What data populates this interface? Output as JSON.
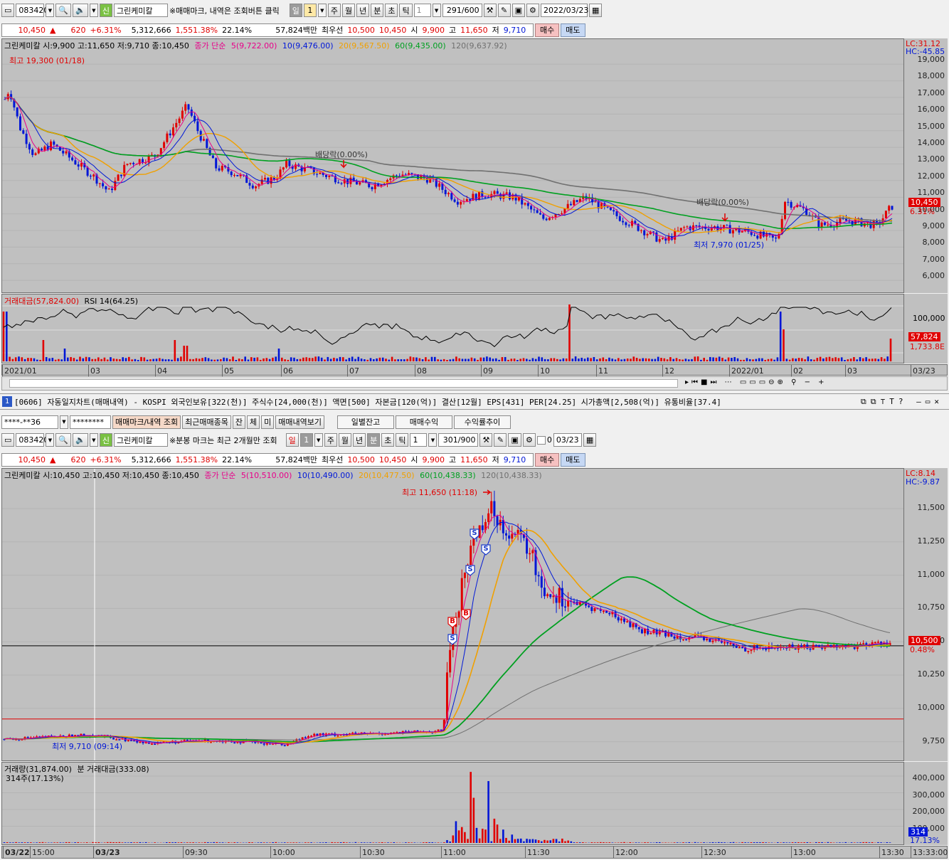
{
  "top_toolbar": {
    "code": "083420",
    "name": "그린케미칼",
    "badge": "신",
    "notice": "※매매마크, 내역은 조회버튼 클릭",
    "periods": [
      "일",
      "1",
      "주",
      "월",
      "년",
      "분",
      "초",
      "틱"
    ],
    "count_value": "1",
    "bars": "291/600",
    "date": "2022/03/23"
  },
  "top_quote": {
    "price": "10,450",
    "arrow": "▲",
    "change": "620",
    "pct": "+6.31%",
    "volume": "5,312,666",
    "vol_pct": "1,551.38%",
    "turnover": "22.14%",
    "amount": "57,824백만",
    "best_label": "최우선",
    "ask": "10,500",
    "bid": "10,450",
    "open_label": "시",
    "open": "9,900",
    "high_label": "고",
    "high": "11,650",
    "low_label": "저",
    "low": "9,710",
    "buy": "매수",
    "sell": "매도"
  },
  "daily_chart": {
    "legend": {
      "name": "그린케미칼 시:9,900 고:11,650 저:9,710 종:10,450",
      "ma_label": "종가 단순",
      "ma5": "5(9,722.00)",
      "ma10": "10(9,476.00)",
      "ma20": "20(9,567.50)",
      "ma60": "60(9,435.00)",
      "ma120": "120(9,637.92)"
    },
    "lc": "LC:31.12",
    "hc": "HC:-45.85",
    "y_ticks": [
      "19,000",
      "18,000",
      "17,000",
      "16,000",
      "15,000",
      "14,000",
      "13,000",
      "12,000",
      "11,000",
      "10,000",
      "9,000",
      "8,000",
      "7,000",
      "6,000"
    ],
    "high_ann": "최고 19,300 (01/18)",
    "low_ann": "최저 7,970 (01/25)",
    "div1": "배당락(0.00%)",
    "div2": "배당락(0.00%)",
    "price_tag": "10,450",
    "pct_tag": "6.31%",
    "colors": {
      "ma5": "#e8008a",
      "ma10": "#0018d8",
      "ma20": "#f0a000",
      "ma60": "#00a020",
      "ma120": "#707070",
      "up": "#e00000",
      "down": "#0016d6"
    }
  },
  "daily_sub": {
    "legend_amount": "거래대금(57,824.00)",
    "legend_rsi": "RSI 14(64.25)",
    "y_tick": "100,000",
    "tag1": "57,824",
    "tag2": "1,733.8E"
  },
  "daily_x": [
    "2021/01",
    "03",
    "04",
    "05",
    "06",
    "07",
    "08",
    "09",
    "10",
    "11",
    "12",
    "2022/01",
    "02",
    "03",
    "03/23"
  ],
  "panel2_title": {
    "num": "1",
    "text": "[0606] 자동일지차트(매매내역) - KOSPI 외국인보유[322(천)] 주식수[24,000(천)] 액면[500] 자본금[120(억)] 결산[12월] EPS[431] PER[24.25] 시가총액[2,508(억)] 유통비율[37.4]"
  },
  "account_bar": {
    "account": "****-**36",
    "password": "********",
    "mark_btn": "매매마크/내역 조회",
    "recent_btn": "최근매매종목",
    "t1": "잔",
    "t2": "체",
    "t3": "미",
    "history_btn": "매매내역보기",
    "btn1": "일별잔고",
    "btn2": "매매수익",
    "btn3": "수익률추이"
  },
  "toolbar2": {
    "code": "083420",
    "name": "그린케미칼",
    "badge": "신",
    "notice": "※분봉 마크는 최근 2개월만 조회",
    "periods": [
      "일",
      "1",
      "주",
      "월",
      "년",
      "분",
      "초",
      "틱"
    ],
    "count_value": "1",
    "bars": "301/900",
    "check": "0",
    "date": "03/23"
  },
  "minute_chart": {
    "legend": {
      "name": "그린케미칼 시:10,450 고:10,450 저:10,450 종:10,450",
      "ma_label": "종가 단순",
      "ma5": "5(10,510.00)",
      "ma10": "10(10,490.00)",
      "ma20": "20(10,477.50)",
      "ma60": "60(10,438.33)",
      "ma120": "120(10,438.33)"
    },
    "lc": "LC:8.14",
    "hc": "HC:-9.87",
    "y_ticks": [
      "11,500",
      "11,250",
      "11,000",
      "10,750",
      "10,500",
      "10,250",
      "10,000",
      "9,750"
    ],
    "high_ann": "최고 11,650 (11:18)",
    "low_ann": "최저 9,710 (09:14)",
    "price_tag": "10,500",
    "pct_tag": "0.48%",
    "marks": [
      "S",
      "S",
      "S",
      "S",
      "B",
      "B",
      "S"
    ]
  },
  "minute_sub": {
    "legend_vol": "거래량(31,874.00)",
    "legend_amt": "분 거래대금(333.08)",
    "sub": "314주(17.13%)",
    "y_ticks": [
      "400,000",
      "300,000",
      "200,000",
      "100,000"
    ],
    "tag1": "314",
    "tag2": "17.13%"
  },
  "minute_x": [
    "03/22",
    "15:00",
    "03/23",
    "09:30",
    "10:00",
    "10:30",
    "11:00",
    "11:30",
    "12:00",
    "12:30",
    "13:00",
    "13:30",
    "13:33:00"
  ]
}
